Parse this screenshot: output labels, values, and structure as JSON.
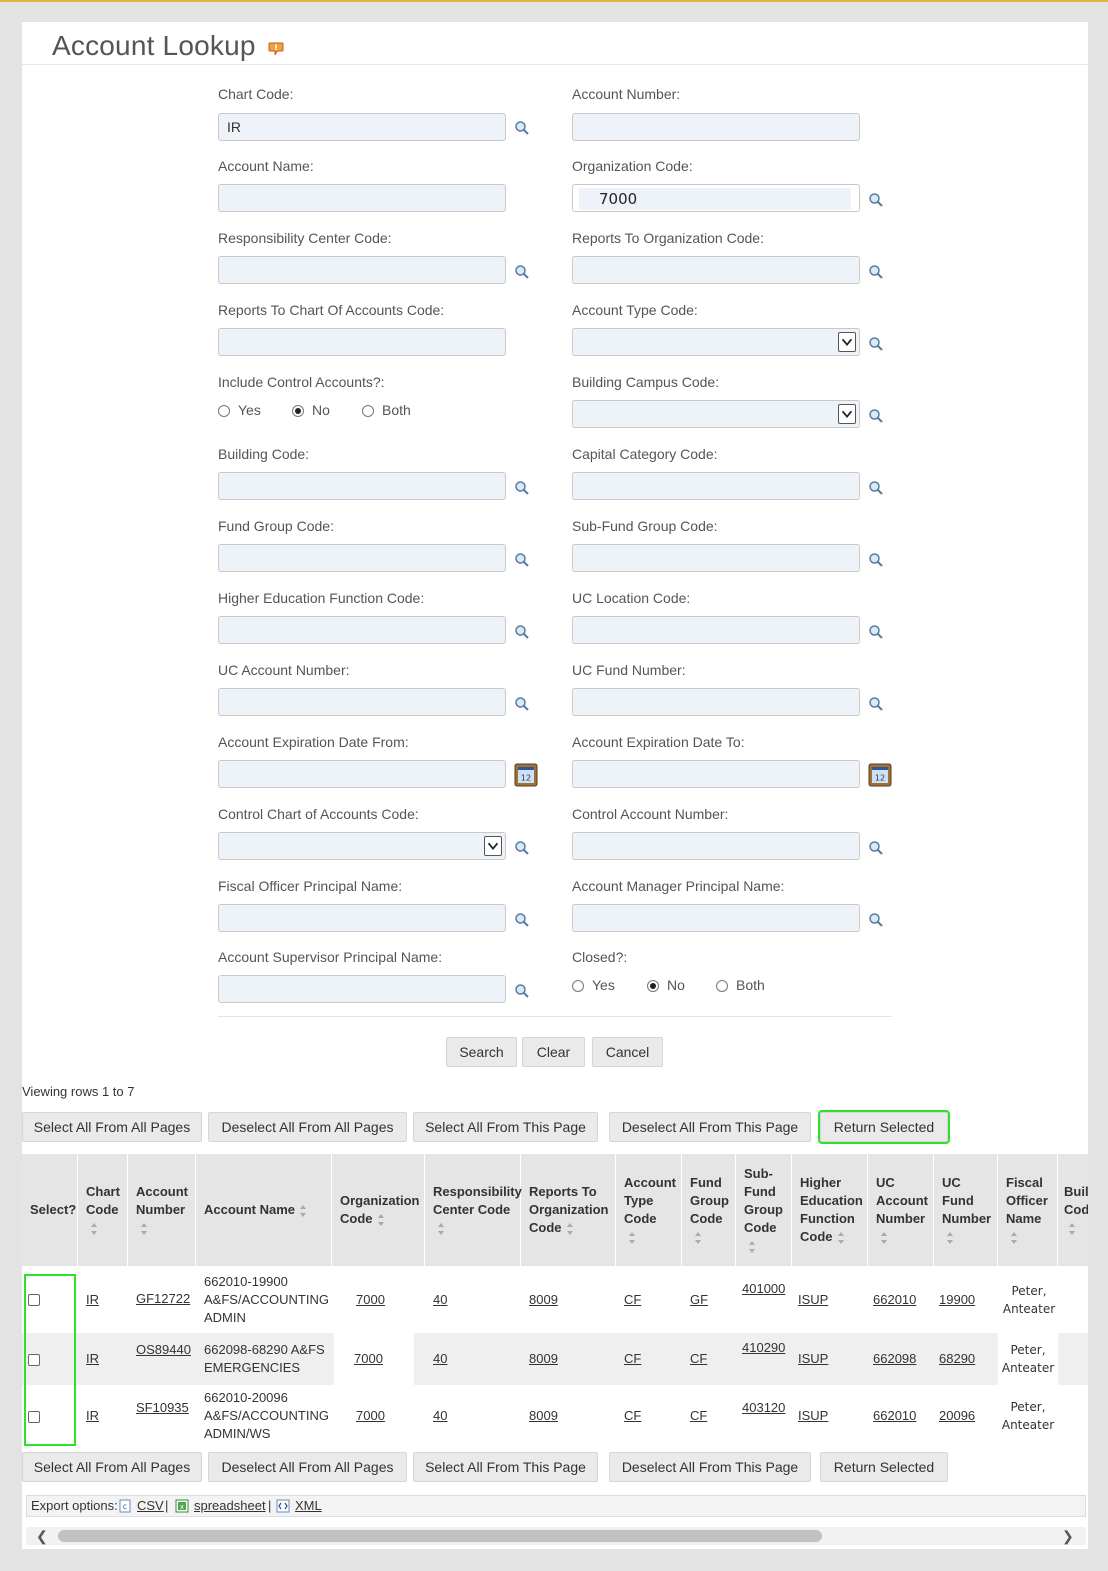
{
  "page": {
    "title": "Account Lookup",
    "help_icon": "help-bubble-icon"
  },
  "form": {
    "chart_code": {
      "label": "Chart Code:",
      "value": "IR"
    },
    "account_number": {
      "label": "Account Number:",
      "value": ""
    },
    "account_name": {
      "label": "Account Name:",
      "value": ""
    },
    "organization_code": {
      "label": "Organization Code:",
      "value": "7000"
    },
    "responsibility_center_code": {
      "label": "Responsibility Center Code:",
      "value": ""
    },
    "reports_to_organization_code": {
      "label": "Reports To Organization Code:",
      "value": ""
    },
    "reports_to_chart_of_accounts_code": {
      "label": "Reports To Chart Of Accounts Code:",
      "value": ""
    },
    "account_type_code": {
      "label": "Account Type Code:",
      "value": ""
    },
    "include_control_accounts": {
      "label": "Include Control Accounts?:",
      "options": [
        "Yes",
        "No",
        "Both"
      ],
      "selected": "No"
    },
    "building_campus_code": {
      "label": "Building Campus Code:",
      "value": ""
    },
    "building_code": {
      "label": "Building Code:",
      "value": ""
    },
    "capital_category_code": {
      "label": "Capital Category Code:",
      "value": ""
    },
    "fund_group_code": {
      "label": "Fund Group Code:",
      "value": ""
    },
    "sub_fund_group_code": {
      "label": "Sub-Fund Group Code:",
      "value": ""
    },
    "higher_education_function_code": {
      "label": "Higher Education Function Code:",
      "value": ""
    },
    "uc_location_code": {
      "label": "UC Location Code:",
      "value": ""
    },
    "uc_account_number": {
      "label": "UC Account Number:",
      "value": ""
    },
    "uc_fund_number": {
      "label": "UC Fund Number:",
      "value": ""
    },
    "account_expiration_date_from": {
      "label": "Account Expiration Date From:",
      "value": ""
    },
    "account_expiration_date_to": {
      "label": "Account Expiration Date To:",
      "value": ""
    },
    "control_chart_of_accounts_code": {
      "label": "Control Chart of Accounts Code:",
      "value": ""
    },
    "control_account_number": {
      "label": "Control Account Number:",
      "value": ""
    },
    "fiscal_officer_principal_name": {
      "label": "Fiscal Officer Principal Name:",
      "value": ""
    },
    "account_manager_principal_name": {
      "label": "Account Manager Principal Name:",
      "value": ""
    },
    "account_supervisor_principal_name": {
      "label": "Account Supervisor Principal Name:",
      "value": ""
    },
    "closed": {
      "label": "Closed?:",
      "options": [
        "Yes",
        "No",
        "Both"
      ],
      "selected": "No"
    }
  },
  "actions": {
    "search": "Search",
    "clear": "Clear",
    "cancel": "Cancel"
  },
  "results": {
    "viewing": "Viewing rows 1 to 7",
    "bulk_buttons": {
      "select_all_pages": "Select All From All Pages",
      "deselect_all_pages": "Deselect All From All Pages",
      "select_all_page": "Select All From This Page",
      "deselect_all_page": "Deselect All From This Page",
      "return_selected": "Return Selected"
    },
    "columns": [
      "Select?",
      "Chart Code",
      "Account Number",
      "Account Name",
      "Organization Code",
      "Responsibility Center Code",
      "Reports To Organization Code",
      "Account Type Code",
      "Fund Group Code",
      "Sub-Fund Group Code",
      "Higher Education Function Code",
      "UC Account Number",
      "UC Fund Number",
      "Fiscal Officer Name",
      "Buil Cod"
    ],
    "rows": [
      {
        "chart": "IR",
        "account_number": "GF12722",
        "account_name": "662010-19900 A&FS/ACCOUNTING ADMIN",
        "org": "7000",
        "resp": "40",
        "reports_to_org": "8009",
        "acct_type": "CF",
        "fund_group": "GF",
        "sub_fund": "401000",
        "hef": "ISUP",
        "uc_account": "662010",
        "uc_fund": "19900",
        "fiscal_officer": "Peter, Anteater"
      },
      {
        "chart": "IR",
        "account_number": "OS89440",
        "account_name": "662098-68290 A&FS EMERGENCIES",
        "org": "7000",
        "resp": "40",
        "reports_to_org": "8009",
        "acct_type": "CF",
        "fund_group": "CF",
        "sub_fund": "410290",
        "hef": "ISUP",
        "uc_account": "662098",
        "uc_fund": "68290",
        "fiscal_officer": "Peter, Anteater"
      },
      {
        "chart": "IR",
        "account_number": "SF10935",
        "account_name": "662010-20096 A&FS/ACCOUNTING ADMIN/WS",
        "org": "7000",
        "resp": "40",
        "reports_to_org": "8009",
        "acct_type": "CF",
        "fund_group": "CF",
        "sub_fund": "403120",
        "hef": "ISUP",
        "uc_account": "662010",
        "uc_fund": "20096",
        "fiscal_officer": "Peter, Anteater"
      }
    ],
    "export": {
      "label": "Export options:",
      "csv": "CSV",
      "spreadsheet": "spreadsheet",
      "xml": "XML",
      "sep": "|"
    }
  }
}
